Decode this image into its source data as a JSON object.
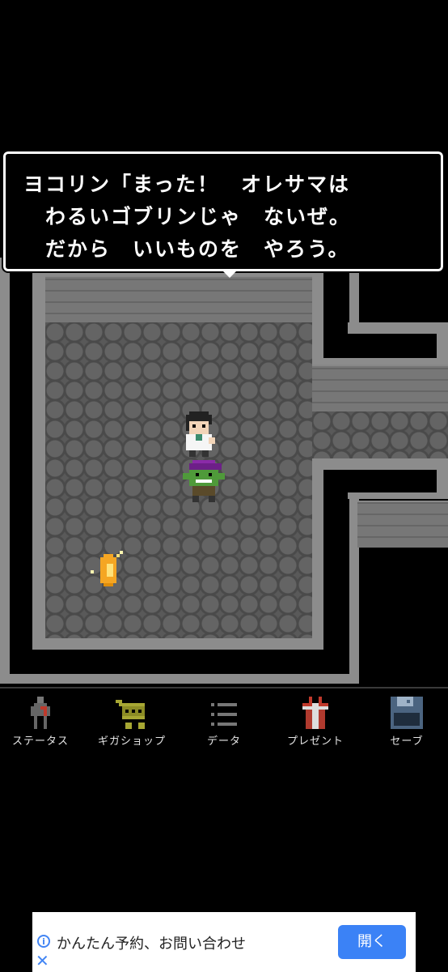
{
  "dialog": {
    "line1": "ヨコリン「まった！　オレサマは",
    "line2": "　わるいゴブリンじゃ　ないぜ。",
    "line3": "　だから　いいものを　やろう。"
  },
  "menu": {
    "items": [
      {
        "label": "ステータス",
        "icon": "person-icon"
      },
      {
        "label": "ギガショップ",
        "icon": "cart-icon"
      },
      {
        "label": "データ",
        "icon": "list-icon"
      },
      {
        "label": "プレゼント",
        "icon": "gift-icon"
      },
      {
        "label": "セーブ",
        "icon": "floppy-disk-icon"
      }
    ]
  },
  "ad": {
    "text": "かんたん予約、お問い合わせ",
    "button": "開く",
    "info_symbol": "i",
    "close_symbol": "✕"
  },
  "colors": {
    "wall": "#8c8c8c",
    "floor": "#595959",
    "dialog_border": "#ffffff",
    "ad_button": "#3b82f6"
  }
}
